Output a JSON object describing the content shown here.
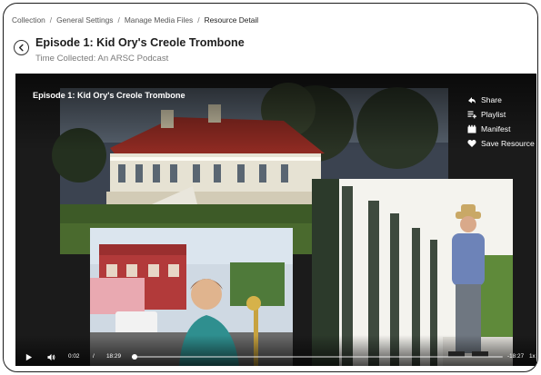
{
  "breadcrumb": {
    "items": [
      "Collection",
      "General Settings",
      "Manage Media Files"
    ],
    "separator": "/",
    "current": "Resource Detail"
  },
  "header": {
    "title": "Episode 1: Kid Ory's Creole Trombone",
    "subtitle": "Time Collected: An ARSC Podcast"
  },
  "player": {
    "overlay_title": "Episode 1: Kid Ory's Creole Trombone",
    "actions": [
      {
        "label": "Share",
        "icon": "share-icon"
      },
      {
        "label": "Playlist",
        "icon": "playlist-add-icon"
      },
      {
        "label": "Manifest",
        "icon": "manifest-icon"
      },
      {
        "label": "Save Resource",
        "icon": "heart-icon"
      }
    ],
    "controls": {
      "current_time": "0:02",
      "time_separator": "/",
      "duration": "18:29",
      "remaining": "-18:27",
      "speed": "1x",
      "progress": 0.002
    }
  }
}
